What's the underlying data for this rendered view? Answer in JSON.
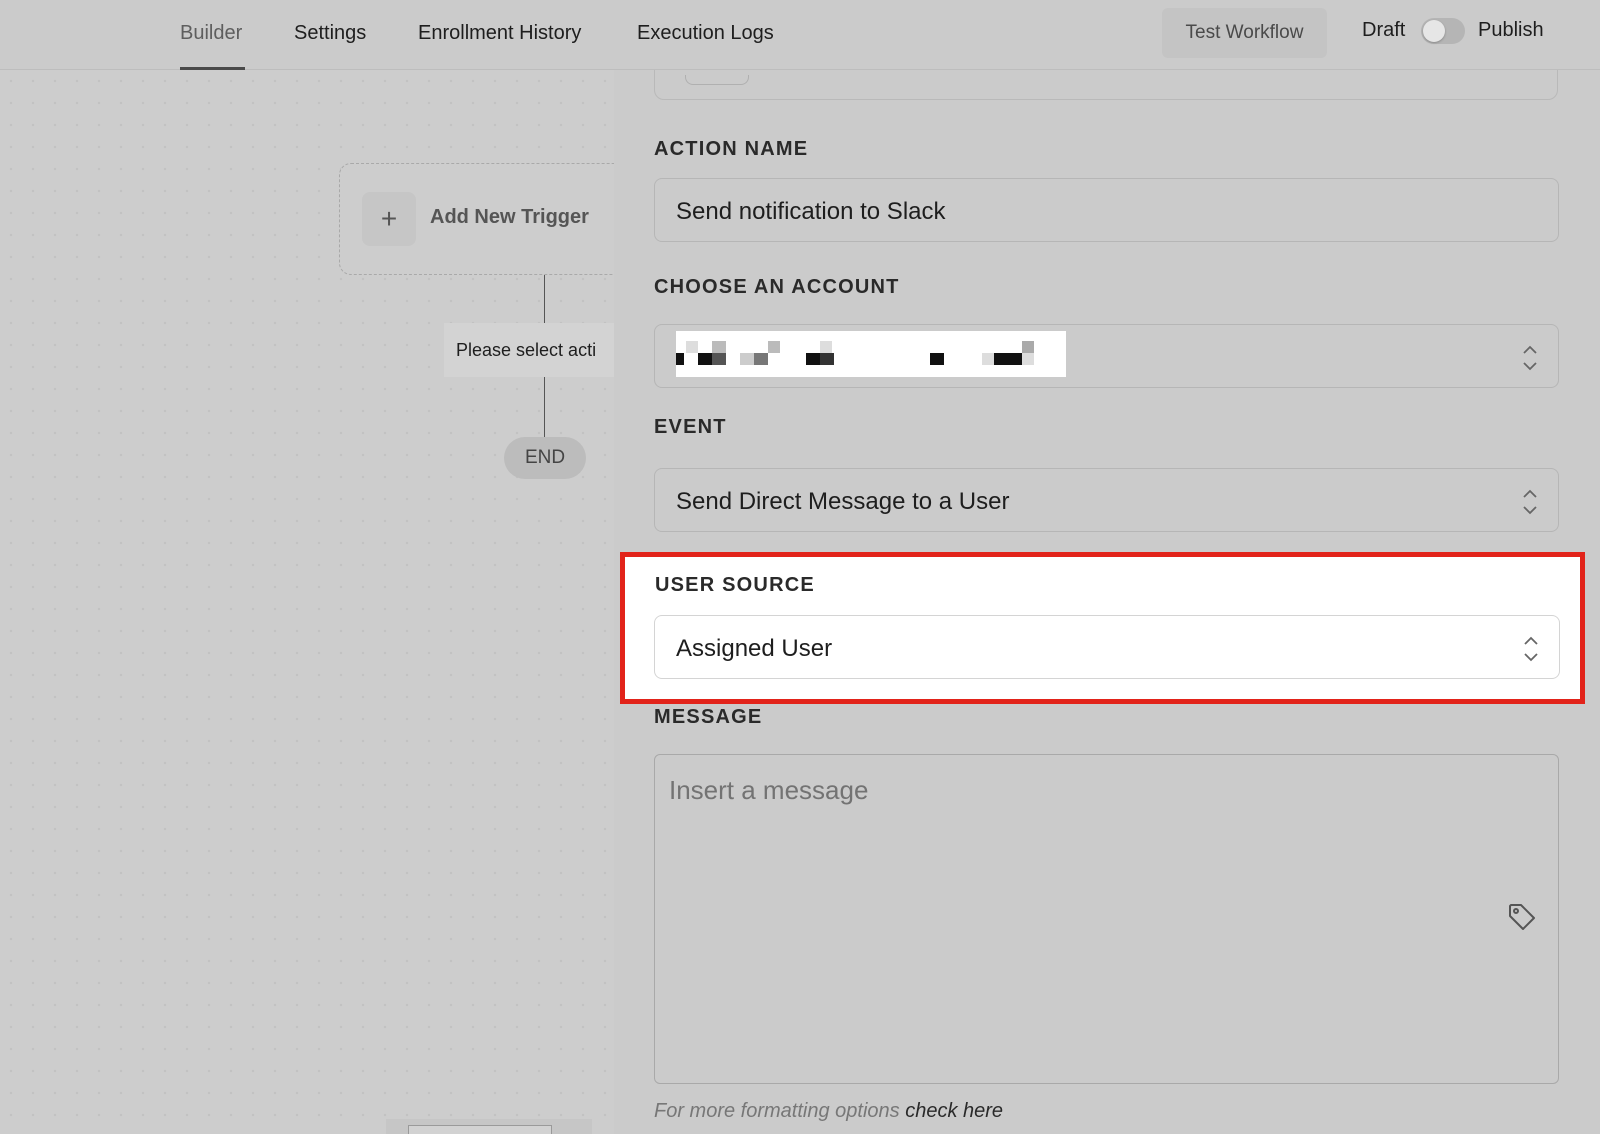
{
  "nav": {
    "tabs": [
      {
        "label": "Builder",
        "active": true
      },
      {
        "label": "Settings",
        "active": false
      },
      {
        "label": "Enrollment History",
        "active": false
      },
      {
        "label": "Execution Logs",
        "active": false
      }
    ],
    "test_button": "Test Workflow",
    "draft_label": "Draft",
    "publish_label": "Publish",
    "publish_toggle_on": false
  },
  "canvas": {
    "add_trigger_label": "Add New Trigger",
    "plus_glyph": "+",
    "select_action_label": "Please select acti",
    "end_label": "END"
  },
  "form": {
    "action_name": {
      "label": "ACTION NAME",
      "value": "Send notification to Slack"
    },
    "account": {
      "label": "CHOOSE AN ACCOUNT",
      "value_redacted": true
    },
    "event": {
      "label": "EVENT",
      "value": "Send Direct Message to a User"
    },
    "user_source": {
      "label": "USER SOURCE",
      "value": "Assigned User",
      "highlighted": true
    },
    "message": {
      "label": "MESSAGE",
      "placeholder": "Insert a message",
      "value": ""
    },
    "help_text": "For more formatting options ",
    "help_link": "check here"
  },
  "icons": {
    "plus": "plus-icon",
    "chevron": "chevron-up-down-icon",
    "tag": "tag-icon"
  },
  "colors": {
    "highlight_border": "#e2231a",
    "overlay": "#cbcbcb"
  }
}
